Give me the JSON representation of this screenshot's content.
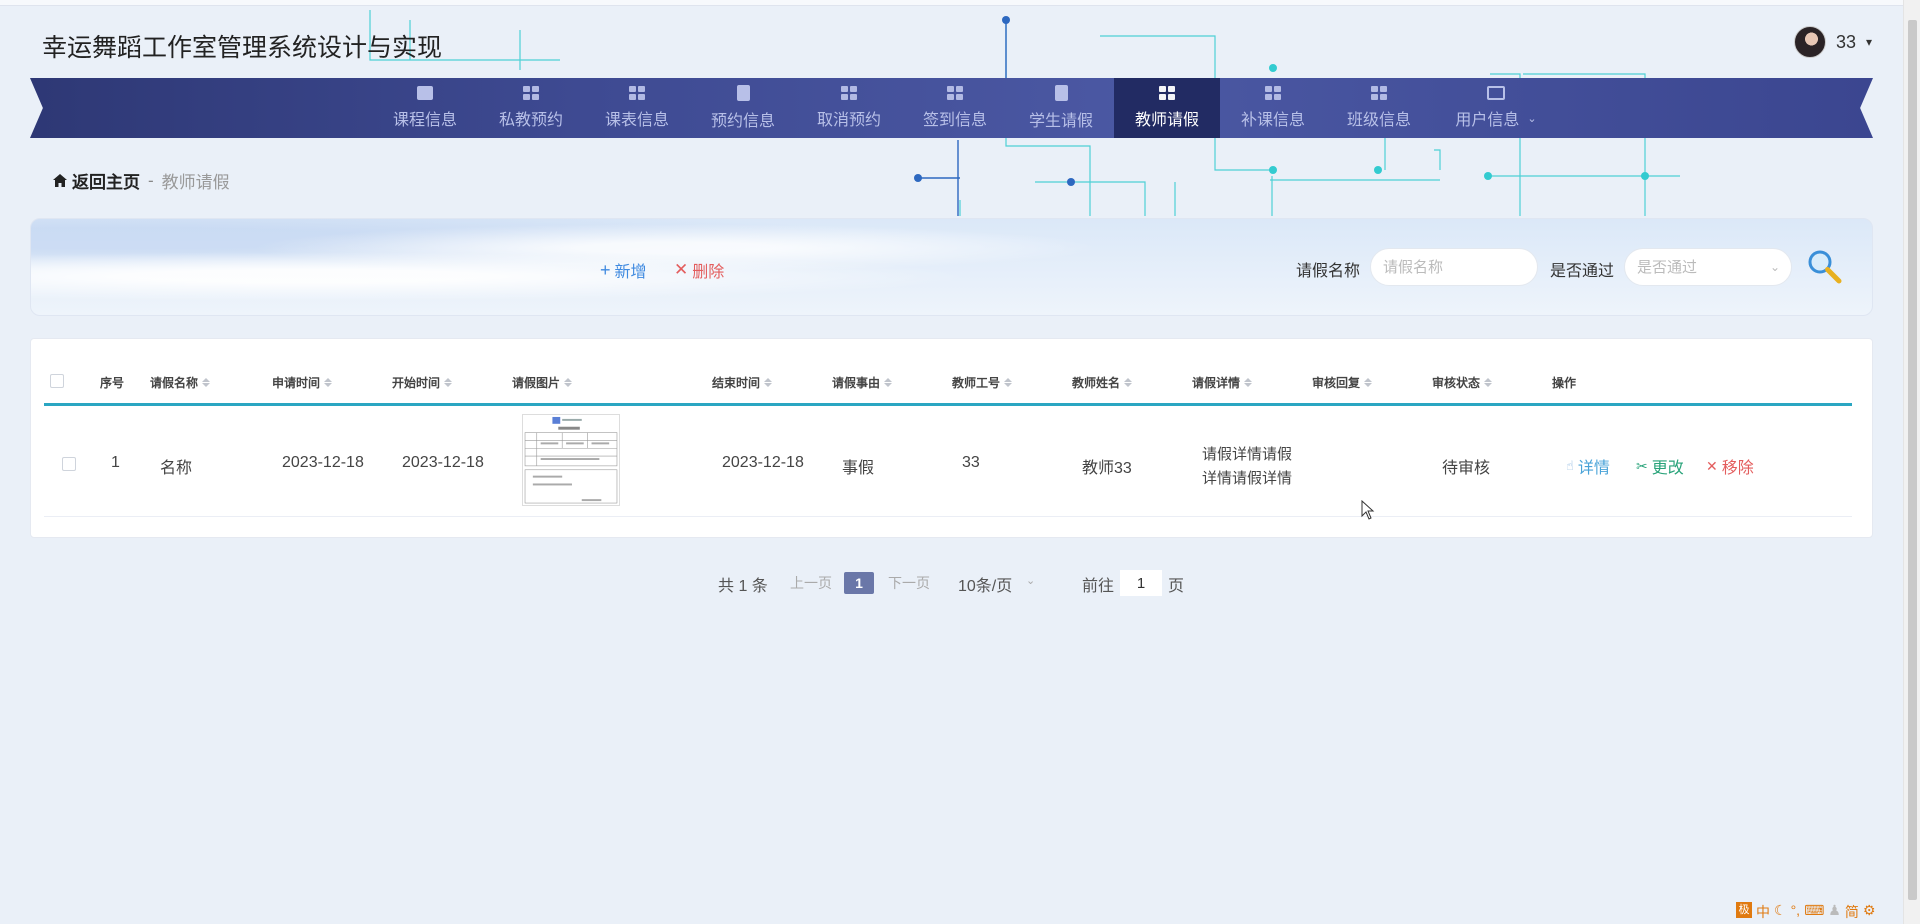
{
  "header": {
    "title": "幸运舞蹈工作室管理系统设计与实现",
    "user": {
      "name": "33",
      "caret": "▾"
    }
  },
  "nav": {
    "items": [
      {
        "label": "课程信息",
        "icon": "chart-icon"
      },
      {
        "label": "私教预约",
        "icon": "grid-icon"
      },
      {
        "label": "课表信息",
        "icon": "grid-icon"
      },
      {
        "label": "预约信息",
        "icon": "clipboard-icon"
      },
      {
        "label": "取消预约",
        "icon": "grid-icon"
      },
      {
        "label": "签到信息",
        "icon": "grid-icon"
      },
      {
        "label": "学生请假",
        "icon": "clipboard-icon"
      },
      {
        "label": "教师请假",
        "icon": "grid-icon",
        "active": true
      },
      {
        "label": "补课信息",
        "icon": "grid-icon"
      },
      {
        "label": "班级信息",
        "icon": "grid-icon"
      },
      {
        "label": "用户信息",
        "icon": "card-icon",
        "dropdown": true
      }
    ]
  },
  "breadcrumb": {
    "home": "返回主页",
    "sep": "-",
    "current": "教师请假"
  },
  "toolbar": {
    "add_label": "新增",
    "delete_label": "删除"
  },
  "search": {
    "name_label": "请假名称",
    "name_placeholder": "请假名称",
    "pass_label": "是否通过",
    "pass_placeholder": "是否通过"
  },
  "table": {
    "columns": [
      "序号",
      "请假名称",
      "申请时间",
      "开始时间",
      "请假图片",
      "结束时间",
      "请假事由",
      "教师工号",
      "教师姓名",
      "请假详情",
      "审核回复",
      "审核状态",
      "操作"
    ],
    "rows": [
      {
        "index": "1",
        "name": "名称",
        "apply_time": "2023-12-18",
        "start_time": "2023-12-18",
        "end_time": "2023-12-18",
        "reason": "事假",
        "teacher_no": "33",
        "teacher_name": "教师33",
        "detail_line1": "请假详情请假",
        "detail_line2": "详情请假详情",
        "reply": "",
        "status": "待审核"
      }
    ],
    "ops": {
      "detail": "详情",
      "edit": "更改",
      "remove": "移除"
    }
  },
  "pagination": {
    "total": "共 1 条",
    "prev": "上一页",
    "current": "1",
    "next": "下一页",
    "page_size": "10条/页",
    "goto_label": "前往",
    "goto_value": "1",
    "page_unit": "页"
  },
  "colors": {
    "nav_bg": "#3e4a92",
    "nav_active": "#222b63",
    "accent": "#2aa6c2",
    "add": "#3f8ae0",
    "danger": "#e35d5d",
    "edit": "#29a37a"
  }
}
